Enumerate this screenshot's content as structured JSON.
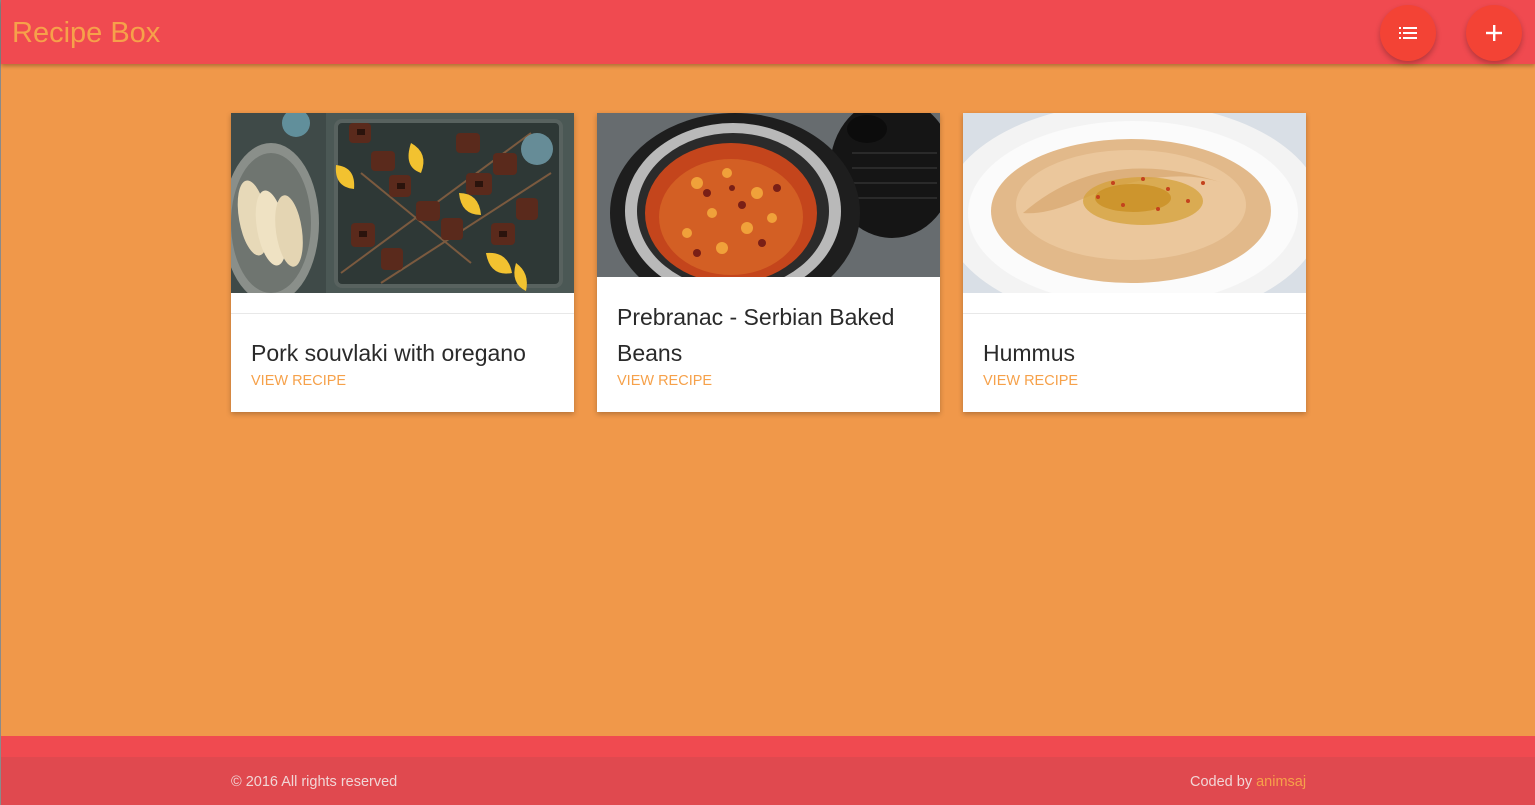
{
  "header": {
    "title": "Recipe Box",
    "list_button_icon": "list-icon",
    "add_button_icon": "plus-icon"
  },
  "cards": [
    {
      "title": "Pork souvlaki with oregano",
      "link_label": "VIEW RECIPE",
      "image": "pork-souvlaki-photo"
    },
    {
      "title": "Prebranac - Serbian Baked Beans",
      "link_label": "VIEW RECIPE",
      "image": "baked-beans-photo"
    },
    {
      "title": "Hummus",
      "link_label": "VIEW RECIPE",
      "image": "hummus-photo"
    }
  ],
  "footer": {
    "copyright": "© 2016 All rights reserved",
    "coded_by_label": "Coded by ",
    "author": "animsaj"
  },
  "colors": {
    "header": "#f04a50",
    "background": "#f0984a",
    "accent": "#f6a14a",
    "fab": "#f34335",
    "footer": "#e0494f"
  }
}
